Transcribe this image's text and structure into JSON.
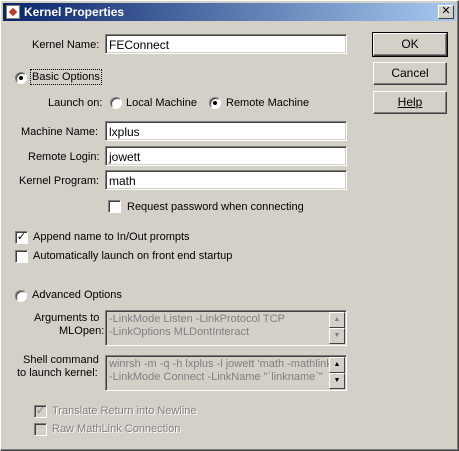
{
  "window": {
    "title": "Kernel Properties",
    "close_glyph": "✕",
    "app_icon": "mathematica-icon"
  },
  "buttons": {
    "ok": "OK",
    "cancel": "Cancel",
    "help": "Help"
  },
  "kernel_name": {
    "label": "Kernel Name:",
    "value": "FEConnect"
  },
  "basic_options": {
    "label": "Basic Options",
    "selected": true,
    "launch_on_label": "Launch on:",
    "local_machine_label": "Local Machine",
    "remote_machine_label": "Remote Machine",
    "launch_on_selected": "Remote Machine",
    "machine_name_label": "Machine Name:",
    "machine_name_value": "lxplus",
    "remote_login_label": "Remote Login:",
    "remote_login_value": "jowett",
    "kernel_program_label": "Kernel Program:",
    "kernel_program_value": "math",
    "request_password_label": "Request password when connecting",
    "request_password_checked": false
  },
  "append_name": {
    "label": "Append name to In/Out prompts",
    "checked": true
  },
  "auto_launch": {
    "label": "Automatically launch on front end startup",
    "checked": false
  },
  "advanced_options": {
    "label": "Advanced Options",
    "selected": false,
    "arguments_label_1": "Arguments to",
    "arguments_label_2": "MLOpen:",
    "arguments_lines": [
      "-LinkMode Listen -LinkProtocol TCP",
      "-LinkOptions MLDontInteract"
    ],
    "shell_label_1": "Shell command",
    "shell_label_2": "to launch kernel:",
    "shell_lines": [
      "winrsh -m -q -h lxplus -l jowett 'math -mathlink",
      "-LinkMode Connect -LinkName \"`linkname`\""
    ],
    "translate_label": "Translate Return into Newline",
    "translate_checked": true,
    "raw_mathlink_label": "Raw MathLink Connection",
    "raw_mathlink_checked": false
  },
  "check_glyph": "✓",
  "scroll_up_glyph": "▲",
  "scroll_down_glyph": "▼",
  "colors": {
    "titlebar_start": "#0a246a",
    "titlebar_end": "#a6caf0",
    "face": "#d4d0c8",
    "disabled_text": "#808080"
  }
}
